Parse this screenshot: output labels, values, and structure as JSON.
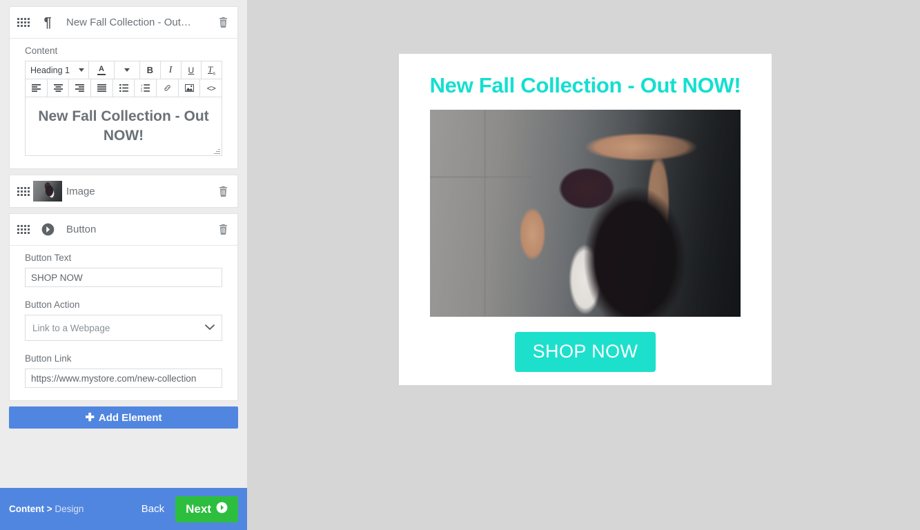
{
  "sidebar": {
    "elements": [
      {
        "type": "text",
        "type_icon": "pilcrow-icon",
        "title": "New Fall Collection - Out…",
        "delete_icon": "trash-icon",
        "drag_icon": "drag-handle-icon",
        "content_label": "Content",
        "editor": {
          "style_select": "Heading 1",
          "buttons_row1": [
            {
              "name": "font-color-icon",
              "label": "A"
            },
            {
              "name": "color-dropdown-caret-icon",
              "label": ""
            },
            {
              "name": "bold-icon",
              "label": "B"
            },
            {
              "name": "italic-icon",
              "label": "I"
            },
            {
              "name": "underline-icon",
              "label": "U"
            },
            {
              "name": "clear-formatting-icon",
              "label": "Tx"
            }
          ],
          "buttons_row2": [
            {
              "name": "align-left-icon"
            },
            {
              "name": "align-center-icon"
            },
            {
              "name": "align-right-icon"
            },
            {
              "name": "align-justify-icon"
            },
            {
              "name": "bullet-list-icon"
            },
            {
              "name": "numbered-list-icon"
            },
            {
              "name": "link-icon"
            },
            {
              "name": "insert-image-icon"
            },
            {
              "name": "source-code-icon"
            }
          ],
          "body_text": "New Fall Collection - Out NOW!",
          "resize_handle": "resize-grip-icon"
        }
      },
      {
        "type": "image",
        "type_icon": "image-thumbnail",
        "title": "Image",
        "delete_icon": "trash-icon"
      },
      {
        "type": "button",
        "type_icon": "arrow-circle-right-icon",
        "title": "Button",
        "delete_icon": "trash-icon",
        "fields": {
          "button_text_label": "Button Text",
          "button_text_value": "SHOP NOW",
          "button_action_label": "Button Action",
          "button_action_value": "Link to a Webpage",
          "button_action_options": [
            "Link to a Webpage"
          ],
          "button_link_label": "Button Link",
          "button_link_value": "https://www.mystore.com/new-collection"
        }
      }
    ],
    "add_element_label": "Add Element",
    "add_element_icon": "plus-icon"
  },
  "footer": {
    "breadcrumb_current": "Content >",
    "breadcrumb_next": "Design",
    "back_label": "Back",
    "next_label": "Next",
    "next_icon": "arrow-circle-right-icon"
  },
  "preview": {
    "heading": "New Fall Collection - Out NOW!",
    "image_alt": "woman-in-beanie-and-sunglasses-photo",
    "button_label": "SHOP NOW"
  },
  "colors": {
    "accent_blue": "#5186e0",
    "accent_green": "#2dbe3f",
    "brand_turquoise": "#14dfd0",
    "button_turquoise": "#1ce0cc",
    "sidebar_bg": "#ececec",
    "canvas_bg": "#d6d6d6",
    "text_gray": "#6b7177"
  }
}
